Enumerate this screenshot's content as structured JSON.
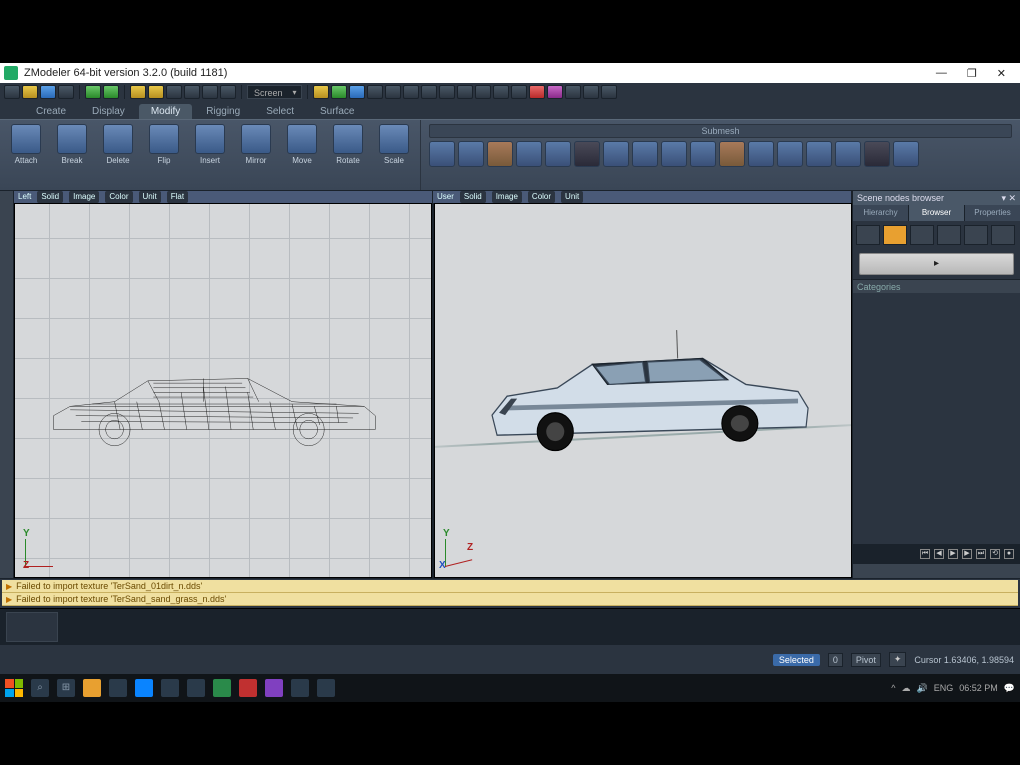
{
  "window": {
    "title": "ZModeler 64-bit version 3.2.0 (build 1181)",
    "controls": {
      "min": "—",
      "max": "❐",
      "close": "✕"
    }
  },
  "quickbar": {
    "dropdown": "Screen"
  },
  "ribbon_tabs": [
    "Create",
    "Display",
    "Modify",
    "Rigging",
    "Select",
    "Surface"
  ],
  "active_tab": "Modify",
  "tools": [
    {
      "label": "Attach"
    },
    {
      "label": "Break"
    },
    {
      "label": "Delete"
    },
    {
      "label": "Flip"
    },
    {
      "label": "Insert"
    },
    {
      "label": "Mirror"
    },
    {
      "label": "Move"
    },
    {
      "label": "Rotate"
    },
    {
      "label": "Scale"
    }
  ],
  "ribbon_strip_label": "Submesh",
  "viewports": {
    "left": {
      "name": "Left",
      "tags": [
        "Solid",
        "Image",
        "Color",
        "Unit",
        "Flat"
      ]
    },
    "right": {
      "name": "User",
      "tags": [
        "Solid",
        "Image",
        "Color",
        "Unit"
      ]
    }
  },
  "right_panel": {
    "title": "Scene nodes browser",
    "tabs": [
      "Hierarchy",
      "Browser",
      "Properties"
    ],
    "active": 1,
    "section": "Categories",
    "button_label": "▸"
  },
  "messages": [
    "Failed to import texture 'TerSand_01dirt_n.dds'",
    "Failed to import texture 'TerSand_sand_grass_n.dds'"
  ],
  "status": {
    "selected_label": "Selected",
    "selected_count": "0",
    "mode_label": "Pivot",
    "cursor_label": "Cursor 1.63406, 1.98594"
  },
  "taskbar": {
    "time": "06:52 PM",
    "date": "",
    "tray": [
      "^",
      "☁",
      "🔊",
      "ENG"
    ]
  }
}
